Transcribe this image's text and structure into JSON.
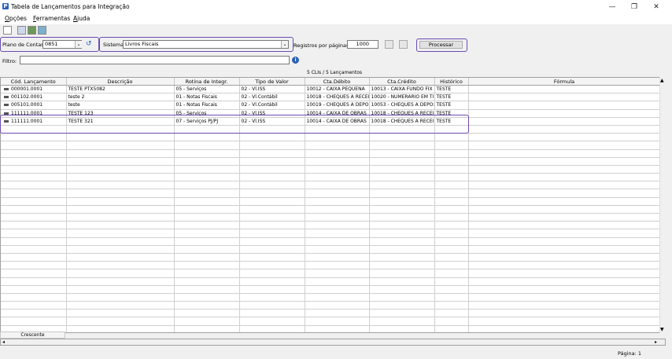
{
  "window": {
    "title": "Tabela de Lançamentos para Integração",
    "minimize": "—",
    "restore": "❐",
    "close": "✕",
    "app_icon": "P"
  },
  "menu": {
    "opcoes": "pções",
    "opcoes_first": "O",
    "ferramentas": "erramentas",
    "ferramentas_first": "F",
    "ajuda": "juda",
    "ajuda_first": "A"
  },
  "toolbar": {
    "icons": [
      "new-document-icon",
      "print-icon",
      "save-icon",
      "export-icon"
    ]
  },
  "controls": {
    "plano_label": "Plano de Contas",
    "plano_value": "0851",
    "sistema_label": "Sistema",
    "sistema_value": "Livros Fiscais",
    "registros_label": "Registros por páginas:",
    "registros_value": "1000",
    "processar_label": "Processar",
    "filtro_label": "Filtro:",
    "filtro_value": ""
  },
  "summary": "5 CLIs / 5 Lançamentos",
  "table": {
    "headers": [
      "Cód. Lançamento",
      "Descrição",
      "Rotina de Integr.",
      "Tipo de Valor",
      "Cta.Débito",
      "Cta.Crédito",
      "Histórico",
      "Fórmula"
    ],
    "rows": [
      [
        "000001.0001",
        "TESTE PTX5082",
        "05 - Serviços",
        "02 - Vl.ISS",
        "10012 - CAIXA PEQUENA",
        "10013 - CAIXA FUNDO FIX",
        "TESTE",
        ""
      ],
      [
        "001102.0001",
        "teste 2",
        "01 - Notas Fiscais",
        "02 - Vl.Contábil",
        "10018 - CHEQUES A RECEI",
        "10020 - NUMERARIO EM TI",
        "TESTE",
        ""
      ],
      [
        "005101.0001",
        "teste",
        "01 - Notas Fiscais",
        "02 - Vl.Contábil",
        "10019 - CHEQUES A DEPO:",
        "10053 - CHEQUES A DEPO:",
        "TESTE",
        ""
      ],
      [
        "111111.0001",
        "TESTE 123",
        "05 - Serviços",
        "02 - Vl.ISS",
        "10014 - CAIXA DE OBRAS",
        "10018 - CHEQUES A RECEI",
        "TESTE",
        ""
      ],
      [
        "111111.0001",
        "TESTE 321",
        "07 - Serviços PJ/PJ",
        "02 - Vl.ISS",
        "10014 - CAIXA DE OBRAS",
        "10018 - CHEQUES A RECEI",
        "TESTE",
        ""
      ]
    ],
    "footer": "Crescente"
  },
  "status": {
    "page": "Página: 1"
  },
  "colors": {
    "highlight_border": "#6b4bb0",
    "info_icon": "#2b62b8"
  }
}
